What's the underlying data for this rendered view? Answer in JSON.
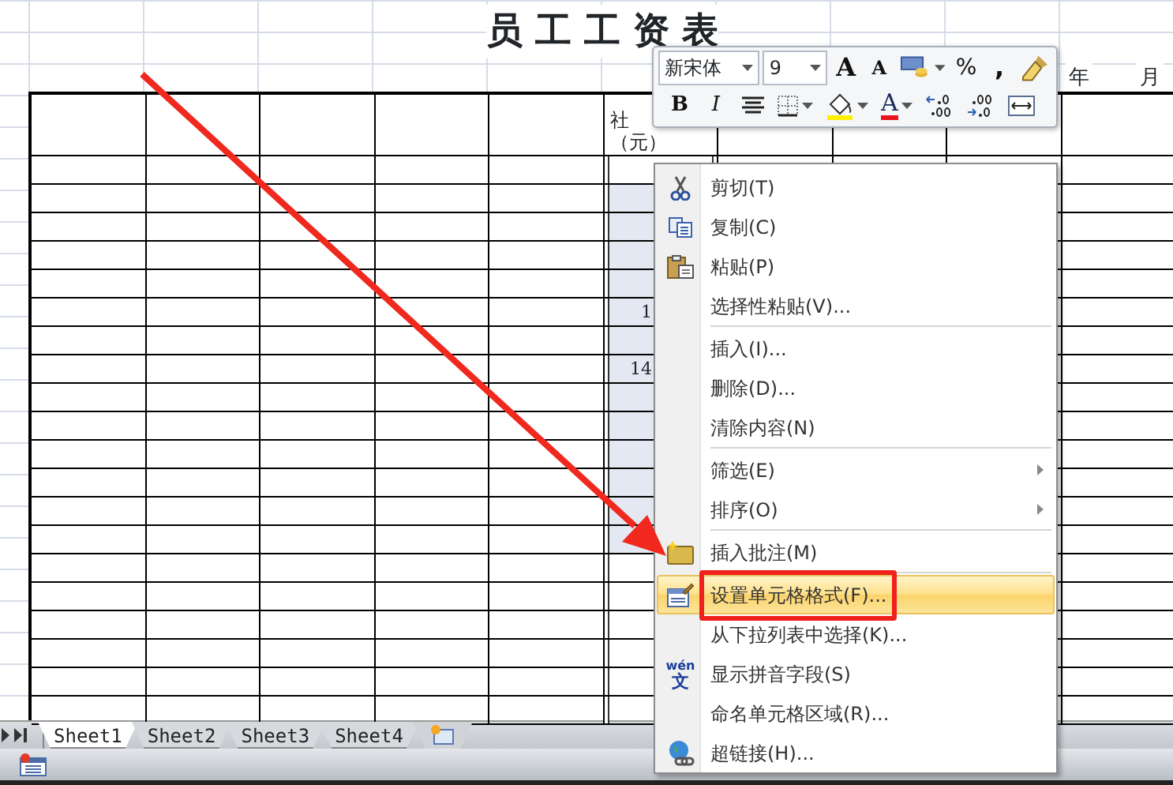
{
  "title": "员 工 工 资 表",
  "date_labels": [
    "年",
    "月"
  ],
  "ss_column": {
    "header_lines": [
      "社",
      "（元）"
    ],
    "cells": [
      {
        "selected": false
      },
      {
        "selected": true
      },
      {
        "selected": true
      },
      {
        "selected": true
      },
      {
        "selected": true
      },
      {
        "selected": true,
        "value": "1"
      },
      {
        "selected": true
      },
      {
        "selected": true,
        "value": "14"
      },
      {
        "selected": true
      },
      {
        "selected": true
      },
      {
        "selected": true
      },
      {
        "selected": true
      },
      {
        "selected": true
      },
      {
        "selected": true
      },
      {
        "selected": false
      },
      {
        "selected": false
      },
      {
        "selected": false
      },
      {
        "selected": false
      },
      {
        "selected": false
      },
      {
        "selected": false
      }
    ]
  },
  "mini_toolbar": {
    "font": "新宋体",
    "size": "9",
    "rows": [
      [
        {
          "kind": "grow-font",
          "label": "A",
          "dropdown": false
        },
        {
          "kind": "shrink-font",
          "label": "A",
          "dropdown": false
        },
        {
          "kind": "accounting",
          "dropdown": true
        },
        {
          "kind": "percent",
          "label": "%",
          "dropdown": false
        },
        {
          "kind": "comma",
          "label": ",",
          "dropdown": false
        },
        {
          "kind": "format-painter",
          "dropdown": false
        }
      ],
      [
        {
          "kind": "bold",
          "label": "B",
          "dropdown": false
        },
        {
          "kind": "italic",
          "label": "I",
          "dropdown": false
        },
        {
          "kind": "center",
          "dropdown": false
        },
        {
          "kind": "borders",
          "dropdown": true
        },
        {
          "kind": "fill-color",
          "dropdown": true
        },
        {
          "kind": "font-color",
          "label": "A",
          "dropdown": true
        },
        {
          "kind": "increase-decimal",
          "dropdown": false
        },
        {
          "kind": "decrease-decimal",
          "dropdown": false
        },
        {
          "kind": "merge",
          "dropdown": false
        }
      ]
    ]
  },
  "context_menu": [
    {
      "kind": "item",
      "label": "剪切(T)",
      "submenu": false,
      "selected": false,
      "annotated": false
    },
    {
      "kind": "item",
      "label": "复制(C)",
      "submenu": false,
      "selected": false,
      "annotated": false
    },
    {
      "kind": "item",
      "label": "粘贴(P)",
      "submenu": false,
      "selected": false,
      "annotated": false
    },
    {
      "kind": "item",
      "label": "选择性粘贴(V)...",
      "submenu": false,
      "selected": false,
      "annotated": false
    },
    {
      "kind": "separator"
    },
    {
      "kind": "item",
      "label": "插入(I)...",
      "submenu": false,
      "selected": false,
      "annotated": false
    },
    {
      "kind": "item",
      "label": "删除(D)...",
      "submenu": false,
      "selected": false,
      "annotated": false
    },
    {
      "kind": "item",
      "label": "清除内容(N)",
      "submenu": false,
      "selected": false,
      "annotated": false
    },
    {
      "kind": "separator"
    },
    {
      "kind": "item",
      "label": "筛选(E)",
      "submenu": true,
      "selected": false,
      "annotated": false
    },
    {
      "kind": "item",
      "label": "排序(O)",
      "submenu": true,
      "selected": false,
      "annotated": false
    },
    {
      "kind": "separator"
    },
    {
      "kind": "item",
      "label": "插入批注(M)",
      "submenu": false,
      "selected": false,
      "annotated": false
    },
    {
      "kind": "separator"
    },
    {
      "kind": "item",
      "label": "设置单元格格式(F)...",
      "submenu": false,
      "selected": true,
      "annotated": true
    },
    {
      "kind": "item",
      "label": "从下拉列表中选择(K)...",
      "submenu": false,
      "selected": false,
      "annotated": false
    },
    {
      "kind": "item",
      "label": "显示拼音字段(S)",
      "icon_text": [
        "wén",
        "文"
      ],
      "submenu": false,
      "selected": false,
      "annotated": false
    },
    {
      "kind": "item",
      "label": "命名单元格区域(R)...",
      "submenu": false,
      "selected": false,
      "annotated": false
    },
    {
      "kind": "item",
      "label": "超链接(H)...",
      "submenu": false,
      "selected": false,
      "annotated": false
    }
  ],
  "sheet_tabs": [
    {
      "label": "Sheet1",
      "selected": true
    },
    {
      "label": "Sheet2",
      "selected": false
    },
    {
      "label": "Sheet3",
      "selected": false
    },
    {
      "label": "Sheet4",
      "selected": false
    }
  ],
  "annotations": [
    {
      "kind": "arrow"
    }
  ]
}
